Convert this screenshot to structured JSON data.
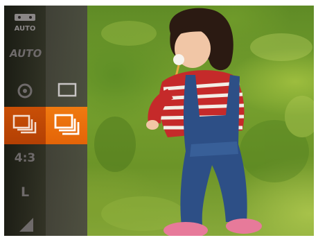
{
  "menu": {
    "items": [
      {
        "id": "scene",
        "label": "AUTO",
        "icon": "scene-auto-icon"
      },
      {
        "id": "auto",
        "label": "AUTO",
        "icon": "auto-mode-icon"
      },
      {
        "id": "iso",
        "label": "",
        "icon": "iso-icon"
      },
      {
        "id": "drive",
        "label": "",
        "icon": "continuous-shooting-icon",
        "selected": true
      },
      {
        "id": "aspect",
        "label": "4:3",
        "icon": ""
      },
      {
        "id": "size",
        "label": "L",
        "icon": ""
      },
      {
        "id": "quality",
        "label": "",
        "icon": "quality-icon"
      }
    ],
    "drive_options": [
      {
        "id": "single",
        "icon": "single-shot-icon",
        "selected": false
      },
      {
        "id": "continuous",
        "icon": "continuous-shooting-icon",
        "selected": true
      }
    ]
  },
  "colors": {
    "selected_primary": "#e46408",
    "selected_secondary": "#b34004",
    "menu_bg": "#1e1b1b"
  }
}
